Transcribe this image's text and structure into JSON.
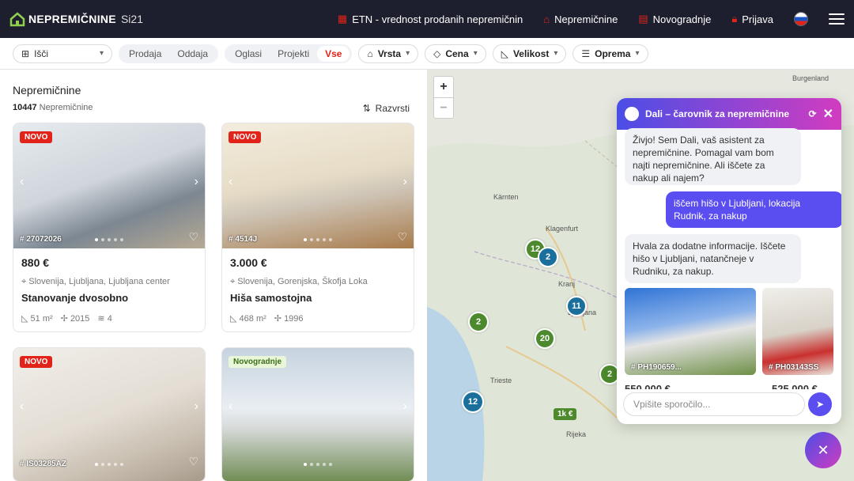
{
  "header": {
    "logo_text": "NEPREMIČNINE",
    "logo_suffix": "Si21",
    "nav": [
      {
        "label": "ETN - vrednost prodanih nepremičnin",
        "icon": "calculator-icon"
      },
      {
        "label": "Nepremičnine",
        "icon": "home-icon"
      },
      {
        "label": "Novogradnje",
        "icon": "building-icon"
      },
      {
        "label": "Prijava",
        "icon": "lock-icon"
      }
    ],
    "language": "Slovenščina"
  },
  "filters": {
    "search_label": "Išči",
    "sale_labels": [
      "Prodaja",
      "Oddaja"
    ],
    "source_labels": [
      "Oglasi",
      "Projekti",
      "Vse"
    ],
    "source_active": "Vse",
    "type_label": "Vrsta",
    "price_label": "Cena",
    "size_label": "Velikost",
    "equipment_label": "Oprema"
  },
  "listing": {
    "title": "Nepremičnine",
    "count": "10447",
    "count_label": "Nepremičnine",
    "sort_label": "Razvrsti",
    "cards": [
      {
        "badge": "NOVO",
        "ref": "# 27072026",
        "price": "880 €",
        "location": "Slovenija, Ljubljana, Ljubljana center",
        "type": "Stanovanje dvosobno",
        "area": "51 m²",
        "year": "2015",
        "rooms": "4",
        "photo_colors": [
          "#d9dfe6",
          "#7f8a97"
        ]
      },
      {
        "badge": "NOVO",
        "ref": "# 4514J",
        "price": "3.000 €",
        "location": "Slovenija, Gorenjska, Škofja Loka",
        "type": "Hiša samostojna",
        "area": "468 m²",
        "year": "1996",
        "rooms": "",
        "photo_colors": [
          "#efe6d4",
          "#a57a4b"
        ]
      },
      {
        "badge": "NOVO",
        "ref": "# IS03285AZ",
        "price": "",
        "location": "",
        "type": "",
        "area": "",
        "year": "",
        "rooms": "",
        "photo_colors": [
          "#ece9e3",
          "#b9b1a5"
        ]
      },
      {
        "badge": "Novogradnje",
        "ref": "",
        "price": "",
        "location": "",
        "type": "",
        "area": "",
        "year": "",
        "rooms": "",
        "photo_colors": [
          "#b9c7d6",
          "#6b8452"
        ]
      }
    ]
  },
  "map": {
    "clusters": [
      {
        "label": "12",
        "color": "green"
      },
      {
        "label": "2",
        "color": "blue"
      },
      {
        "label": "11",
        "color": "blue"
      },
      {
        "label": "2",
        "color": "green"
      },
      {
        "label": "20",
        "color": "green"
      },
      {
        "label": "2",
        "color": "green"
      },
      {
        "label": "12",
        "color": "blue"
      }
    ],
    "price_tag": "1k €",
    "labels": [
      "Kärnten",
      "Klagenfurt",
      "Kranj",
      "Ljubljana",
      "Trieste",
      "Rijeka",
      "Burgenland"
    ]
  },
  "chat": {
    "title": "Dali – čarovnik za nepremičnine",
    "messages": [
      {
        "from": "bot",
        "text": "Živjo! Sem Dali, vaš asistent za nepremičnine. Pomagal vam bom najti nepremičnine. Ali iščete za nakup ali najem?"
      },
      {
        "from": "user",
        "text": "iščem hišo v Ljubljani, lokacija Rudnik, za nakup"
      },
      {
        "from": "bot",
        "text": "Hvala za dodatne informacije. Iščete hišo v Ljubljani, natančneje v Rudniku, za nakup."
      }
    ],
    "props": [
      {
        "ref": "# PH190659...",
        "price": "550.000 €"
      },
      {
        "ref": "# PH03143SS",
        "price": "525.000 €"
      }
    ],
    "input_placeholder": "Vpišite sporočilo..."
  },
  "colors": {
    "accent": "#e2231a",
    "map_green": "#4c8a2d",
    "map_blue": "#1a6f9c",
    "chat_start": "#4b4ee6",
    "chat_end": "#d13cc0"
  }
}
